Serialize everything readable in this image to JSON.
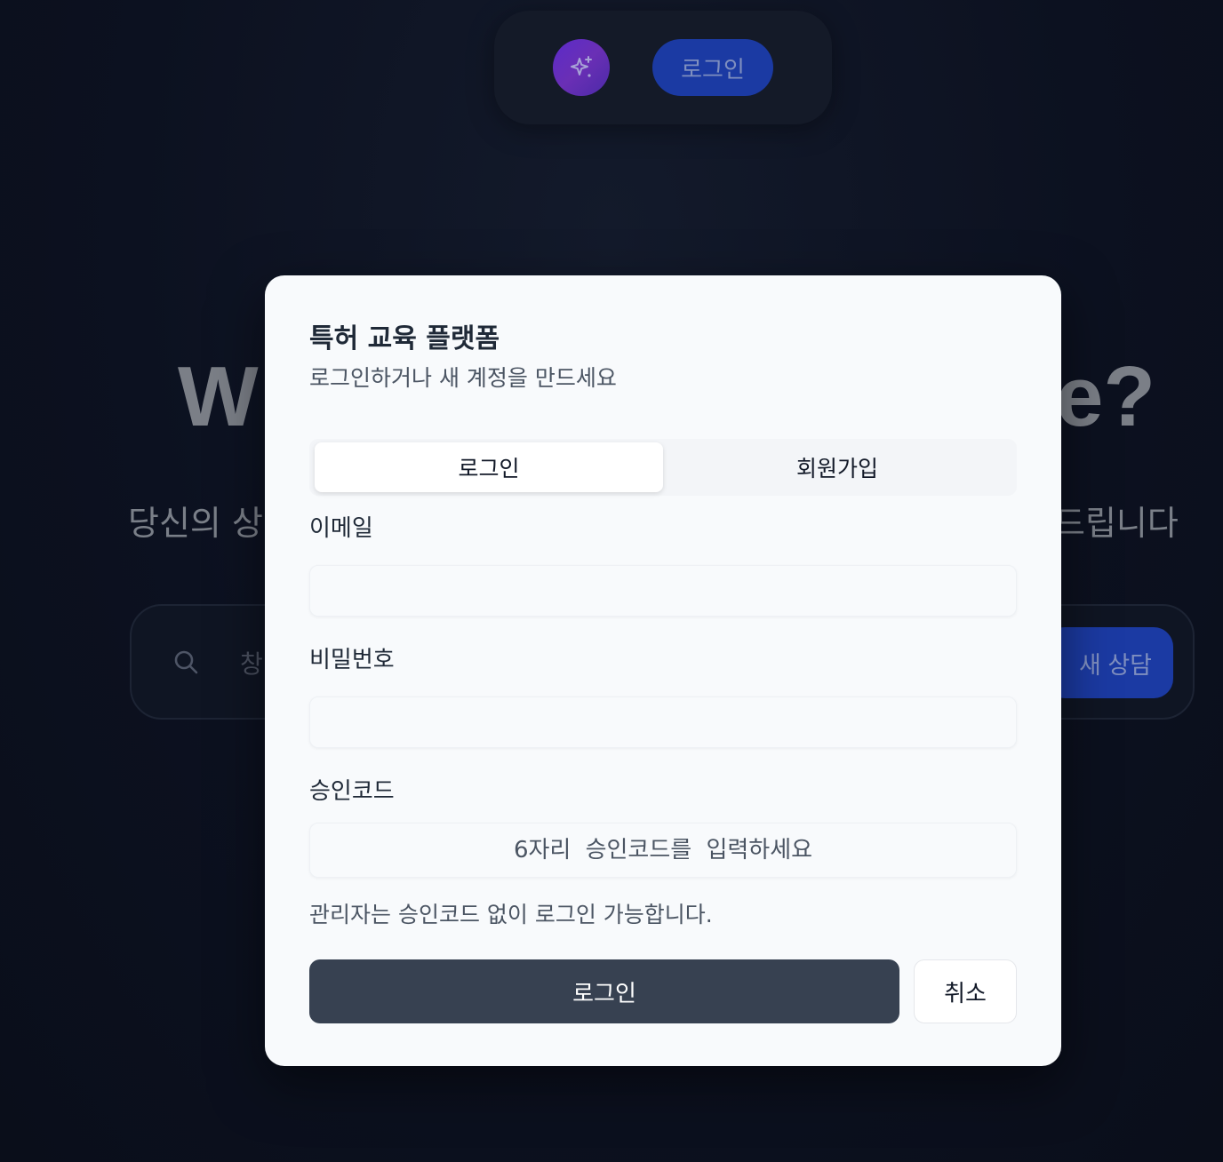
{
  "background": {
    "top_nav": {
      "spark_icon": "sparkles-icon",
      "login_label": "로그인"
    },
    "hero": {
      "title_left_fragment": "W",
      "title_right_fragment": "e?",
      "subtitle_left_fragment": "당신의 상",
      "subtitle_right_fragment": "드립니다"
    },
    "search": {
      "icon": "search-icon",
      "placeholder_fragment": "창",
      "new_chat_label": "새 상담"
    }
  },
  "modal": {
    "title": "특허 교육 플랫폼",
    "description": "로그인하거나 새 계정을 만드세요",
    "tabs": [
      {
        "label": "로그인",
        "active": true
      },
      {
        "label": "회원가입",
        "active": false
      }
    ],
    "fields": {
      "email_label": "이메일",
      "email_value": "",
      "password_label": "비밀번호",
      "password_value": "",
      "code_label": "승인코드",
      "code_placeholder": "6자리 승인코드를 입력하세요"
    },
    "hint": "관리자는 승인코드 없이 로그인 가능합니다.",
    "submit_label": "로그인",
    "cancel_label": "취소"
  },
  "colors": {
    "background": "#0c1120",
    "modal_bg": "#f8fafc",
    "primary_dark": "#374151",
    "accent_blue": "#1b3aa3",
    "accent_purple": "#5b2bc9"
  }
}
